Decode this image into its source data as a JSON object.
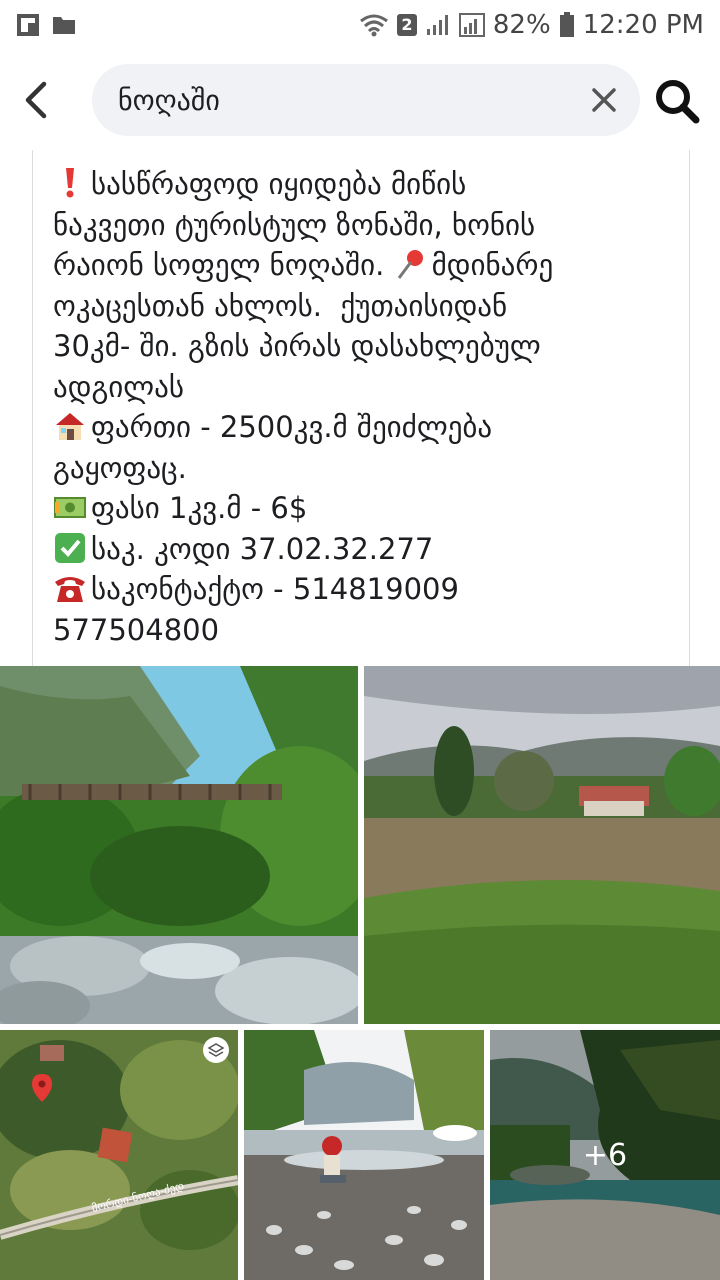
{
  "status_bar": {
    "badge": "2",
    "battery": "82%",
    "time": "12:20 PM"
  },
  "search": {
    "query": "ნოღაში"
  },
  "post": {
    "lines": [
      "სასწრაფოდ იყიდება მიწის",
      "ნაკვეთი ტურისტულ ზონაში, ხონის",
      "რაიონ სოფელ ნოღაში.",
      "მდინარე",
      "ოკაცესთან ახლოს.  ქუთაისიდან",
      "30კმ- ში. გზის პირას დასახლებულ",
      "ადგილას",
      "ფართი - 2500კვ.მ შეიძლება",
      "გაყოფაც.",
      "ფასი 1კვ.მ - 6$",
      "საკ. კოდი 37.02.32.277",
      "საკონტაქტო - 514819009",
      "577504800"
    ]
  },
  "photos": {
    "map_road_label": "მორდი-ნოღა-ძედ",
    "more_count": "+6"
  },
  "icons": [
    "flipboard-icon",
    "folder-icon",
    "wifi-icon",
    "signal-icon",
    "battery-icon",
    "back-arrow-icon",
    "clear-icon",
    "search-icon",
    "exclamation-emoji",
    "pushpin-emoji",
    "house-emoji",
    "money-emoji",
    "checkmark-emoji",
    "telephone-emoji",
    "map-layers-icon",
    "map-pin-icon"
  ],
  "colors": {
    "search_bg": "#f0f2f5",
    "text": "#1c1e21",
    "checkmark": "#4caf50",
    "alert_red": "#e53935"
  }
}
